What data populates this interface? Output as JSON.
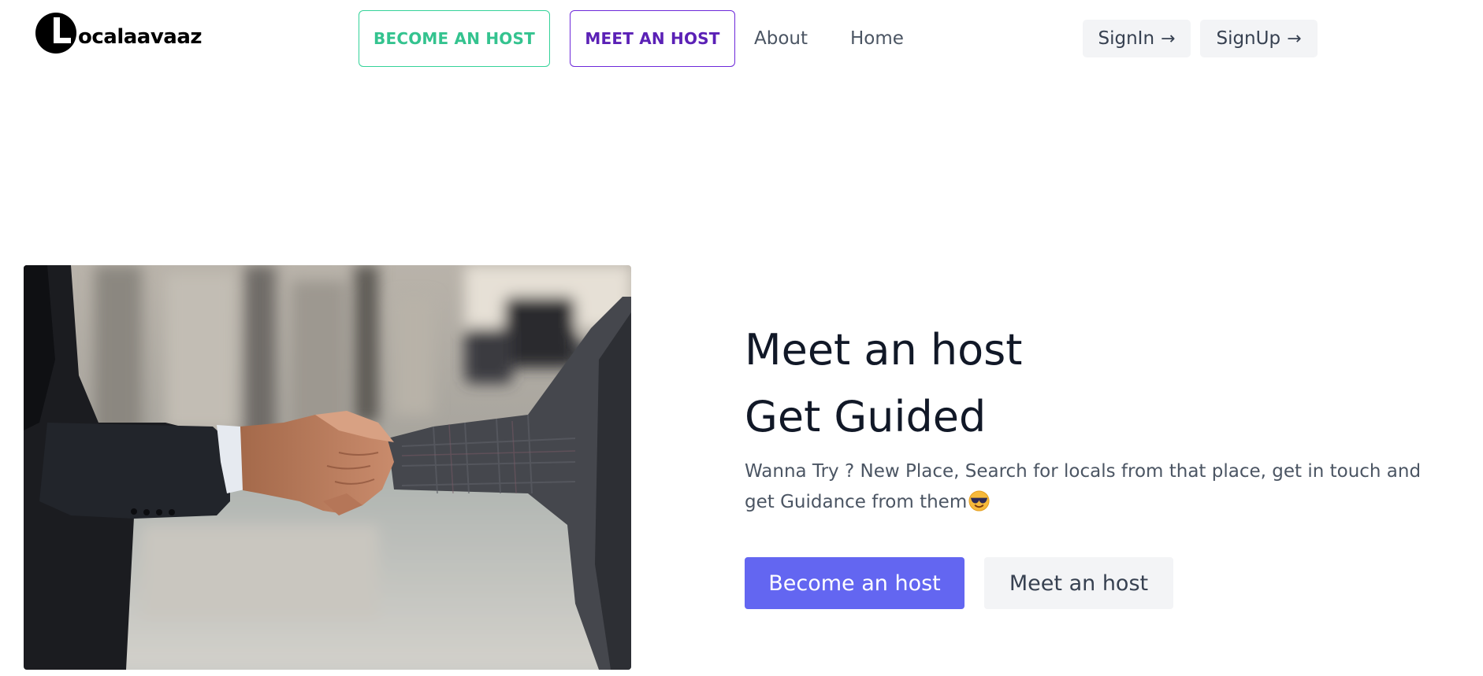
{
  "brand": {
    "name": "ocalaavaaz",
    "logo_icon": "letter-l-circle-logo"
  },
  "nav": {
    "become_host_label": "BECOME AN HOST",
    "meet_host_label": "MEET AN HOST",
    "about_label": "About",
    "home_label": "Home"
  },
  "auth": {
    "signin_label": "SignIn",
    "signup_label": "SignUp",
    "arrow_icon": "arrow-right-icon",
    "arrow_glyph": "→"
  },
  "hero": {
    "title_line1": "Meet an host",
    "title_line2": "Get Guided",
    "description": "Wanna Try ? New Place, Search for locals from that place, get in touch and get Guidance from them",
    "description_icon": "sunglasses-smiley-emoji",
    "image": "handshake-photo",
    "primary_button_label": "Become an host",
    "secondary_button_label": "Meet an host"
  },
  "colors": {
    "green_accent": "#34d399",
    "purple_accent": "#6d28d9",
    "primary_button": "#6366f1",
    "secondary_button": "#f3f4f6",
    "heading": "#111827",
    "body_text": "#4b5563"
  }
}
